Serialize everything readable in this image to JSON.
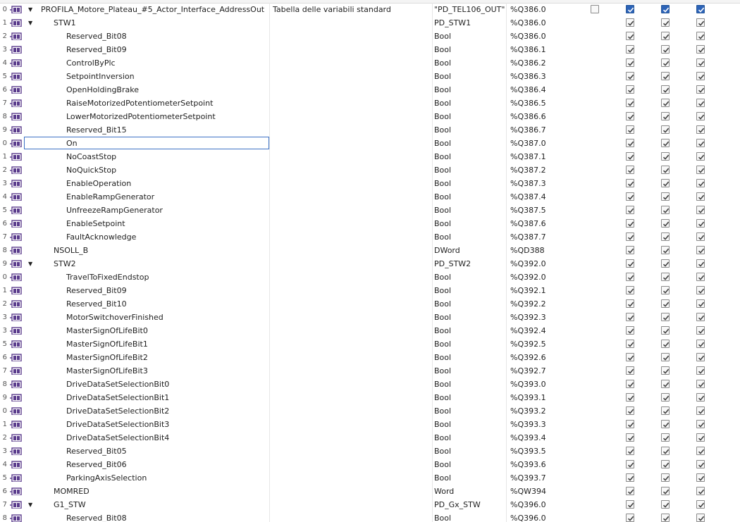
{
  "header_row": {
    "index": "0",
    "name": "PROFILA_Motore_Plateau_#5_Actor_Interface_AddressOut",
    "comment": "Tabella delle variabili standard",
    "data_type": "\"PD_TEL106_OUT\"",
    "address": "%Q386.0",
    "hidden": false,
    "accessible": true,
    "writable": true,
    "visible": true
  },
  "rows": [
    {
      "index": "1",
      "level": 1,
      "expanded": true,
      "name": "STW1",
      "data_type": "PD_STW1",
      "address": "%Q386.0"
    },
    {
      "index": "2",
      "level": 2,
      "name": "Reserved_Bit08",
      "data_type": "Bool",
      "address": "%Q386.0"
    },
    {
      "index": "3",
      "level": 2,
      "name": "Reserved_Bit09",
      "data_type": "Bool",
      "address": "%Q386.1"
    },
    {
      "index": "4",
      "level": 2,
      "name": "ControlByPlc",
      "data_type": "Bool",
      "address": "%Q386.2"
    },
    {
      "index": "5",
      "level": 2,
      "name": "SetpointInversion",
      "data_type": "Bool",
      "address": "%Q386.3"
    },
    {
      "index": "6",
      "level": 2,
      "name": "OpenHoldingBrake",
      "data_type": "Bool",
      "address": "%Q386.4"
    },
    {
      "index": "7",
      "level": 2,
      "name": "RaiseMotorizedPotentiometerSetpoint",
      "data_type": "Bool",
      "address": "%Q386.5"
    },
    {
      "index": "8",
      "level": 2,
      "name": "LowerMotorizedPotentiometerSetpoint",
      "data_type": "Bool",
      "address": "%Q386.6"
    },
    {
      "index": "9",
      "level": 2,
      "name": "Reserved_Bit15",
      "data_type": "Bool",
      "address": "%Q386.7"
    },
    {
      "index": "0",
      "level": 2,
      "name": "On",
      "data_type": "Bool",
      "address": "%Q387.0",
      "selected": true
    },
    {
      "index": "1",
      "level": 2,
      "name": "NoCoastStop",
      "data_type": "Bool",
      "address": "%Q387.1"
    },
    {
      "index": "2",
      "level": 2,
      "name": "NoQuickStop",
      "data_type": "Bool",
      "address": "%Q387.2"
    },
    {
      "index": "3",
      "level": 2,
      "name": "EnableOperation",
      "data_type": "Bool",
      "address": "%Q387.3"
    },
    {
      "index": "4",
      "level": 2,
      "name": "EnableRampGenerator",
      "data_type": "Bool",
      "address": "%Q387.4"
    },
    {
      "index": "5",
      "level": 2,
      "name": "UnfreezeRampGenerator",
      "data_type": "Bool",
      "address": "%Q387.5"
    },
    {
      "index": "6",
      "level": 2,
      "name": "EnableSetpoint",
      "data_type": "Bool",
      "address": "%Q387.6"
    },
    {
      "index": "7",
      "level": 2,
      "name": "FaultAcknowledge",
      "data_type": "Bool",
      "address": "%Q387.7"
    },
    {
      "index": "8",
      "level": 1,
      "name": "NSOLL_B",
      "data_type": "DWord",
      "address": "%QD388"
    },
    {
      "index": "9",
      "level": 1,
      "expanded": true,
      "name": "STW2",
      "data_type": "PD_STW2",
      "address": "%Q392.0"
    },
    {
      "index": "0",
      "level": 2,
      "name": "TravelToFixedEndstop",
      "data_type": "Bool",
      "address": "%Q392.0"
    },
    {
      "index": "1",
      "level": 2,
      "name": "Reserved_Bit09",
      "data_type": "Bool",
      "address": "%Q392.1"
    },
    {
      "index": "2",
      "level": 2,
      "name": "Reserved_Bit10",
      "data_type": "Bool",
      "address": "%Q392.2"
    },
    {
      "index": "3",
      "level": 2,
      "name": "MotorSwitchoverFinished",
      "data_type": "Bool",
      "address": "%Q392.3"
    },
    {
      "index": "3",
      "level": 2,
      "name": "MasterSignOfLifeBit0",
      "data_type": "Bool",
      "address": "%Q392.4"
    },
    {
      "index": "5",
      "level": 2,
      "name": "MasterSignOfLifeBit1",
      "data_type": "Bool",
      "address": "%Q392.5"
    },
    {
      "index": "6",
      "level": 2,
      "name": "MasterSignOfLifeBit2",
      "data_type": "Bool",
      "address": "%Q392.6"
    },
    {
      "index": "7",
      "level": 2,
      "name": "MasterSignOfLifeBit3",
      "data_type": "Bool",
      "address": "%Q392.7"
    },
    {
      "index": "8",
      "level": 2,
      "name": "DriveDataSetSelectionBit0",
      "data_type": "Bool",
      "address": "%Q393.0"
    },
    {
      "index": "9",
      "level": 2,
      "name": "DriveDataSetSelectionBit1",
      "data_type": "Bool",
      "address": "%Q393.1"
    },
    {
      "index": "0",
      "level": 2,
      "name": "DriveDataSetSelectionBit2",
      "data_type": "Bool",
      "address": "%Q393.2"
    },
    {
      "index": "1",
      "level": 2,
      "name": "DriveDataSetSelectionBit3",
      "data_type": "Bool",
      "address": "%Q393.3"
    },
    {
      "index": "2",
      "level": 2,
      "name": "DriveDataSetSelectionBit4",
      "data_type": "Bool",
      "address": "%Q393.4"
    },
    {
      "index": "3",
      "level": 2,
      "name": "Reserved_Bit05",
      "data_type": "Bool",
      "address": "%Q393.5"
    },
    {
      "index": "4",
      "level": 2,
      "name": "Reserved_Bit06",
      "data_type": "Bool",
      "address": "%Q393.6"
    },
    {
      "index": "5",
      "level": 2,
      "name": "ParkingAxisSelection",
      "data_type": "Bool",
      "address": "%Q393.7"
    },
    {
      "index": "6",
      "level": 1,
      "name": "MOMRED",
      "data_type": "Word",
      "address": "%QW394"
    },
    {
      "index": "7",
      "level": 1,
      "expanded": true,
      "name": "G1_STW",
      "data_type": "PD_Gx_STW",
      "address": "%Q396.0"
    },
    {
      "index": "8",
      "level": 2,
      "name": "Reserved_Bit08",
      "data_type": "Bool",
      "address": "%Q396.0"
    }
  ],
  "colors": {
    "selection_border": "#3a6fc4",
    "checkbox_blue": "#2c63b8",
    "tag_icon_purple": "#5a3b8c"
  },
  "icons": {
    "expand": "triangle-down-icon",
    "tag": "plc-tag-icon",
    "check": "checkmark-icon"
  }
}
